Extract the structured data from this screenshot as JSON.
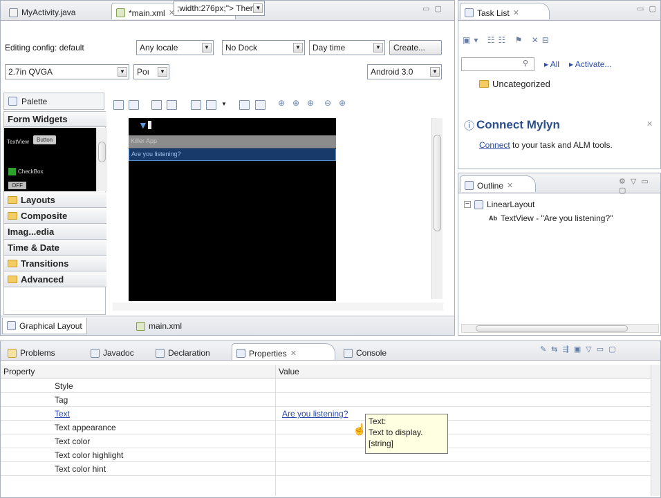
{
  "editor": {
    "tabs": [
      {
        "label": "MyActivity.java"
      },
      {
        "label": "*main.xml"
      }
    ],
    "config": {
      "editing_config_label": "Editing config: default",
      "locale": "Any locale",
      "dock": "No Dock",
      "time": "Day time",
      "create_button": "Create...",
      "device": "2.7in QVGA",
      "orientation": "Poı",
      "theme": "Theme",
      "api": "Android 3.0"
    },
    "palette": {
      "header": "Palette",
      "form_widgets": "Form Widgets",
      "preview_textview": "TextView",
      "preview_button": "Button",
      "preview_checkbox": "CheckBox",
      "preview_toggle": "OFF",
      "categories": [
        "Layouts",
        "Composite",
        "Imag...edia",
        "Time & Date",
        "Transitions",
        "Advanced"
      ]
    },
    "canvas": {
      "app_title": "Killer App",
      "text_view": "Are you listening?"
    },
    "bottom_tabs": [
      "Graphical Layout",
      "main.xml"
    ]
  },
  "task_list": {
    "tab": "Task List",
    "filter_all": "All",
    "filter_activate": "Activate...",
    "uncategorized": "Uncategorized",
    "mylyn_title": "Connect Mylyn",
    "mylyn_link": "Connect",
    "mylyn_text": " to your task and ALM tools."
  },
  "outline": {
    "tab": "Outline",
    "tree": [
      {
        "label": "LinearLayout"
      },
      {
        "label": "TextView - \"Are you listening?\""
      }
    ]
  },
  "bottom_panel": {
    "tabs": [
      "Problems",
      "Javadoc",
      "Declaration",
      "Properties",
      "Console"
    ],
    "columns": [
      "Property",
      "Value"
    ],
    "rows": [
      {
        "name": "Style",
        "value": ""
      },
      {
        "name": "Tag",
        "value": ""
      },
      {
        "name": "Text",
        "value": "Are you listening?"
      },
      {
        "name": "Text appearance",
        "value": ""
      },
      {
        "name": "Text color",
        "value": ""
      },
      {
        "name": "Text color highlight",
        "value": ""
      },
      {
        "name": "Text color hint",
        "value": ""
      }
    ],
    "tooltip": {
      "line1": "Text:",
      "line2": "Text to display.",
      "line3": "[string]"
    }
  },
  "colors": {
    "canvas_bg": "#000000",
    "title_bar": "#8c8c8c",
    "selection": "#173a6a",
    "link": "#2a49a8",
    "tooltip_bg": "#ffffe1"
  }
}
